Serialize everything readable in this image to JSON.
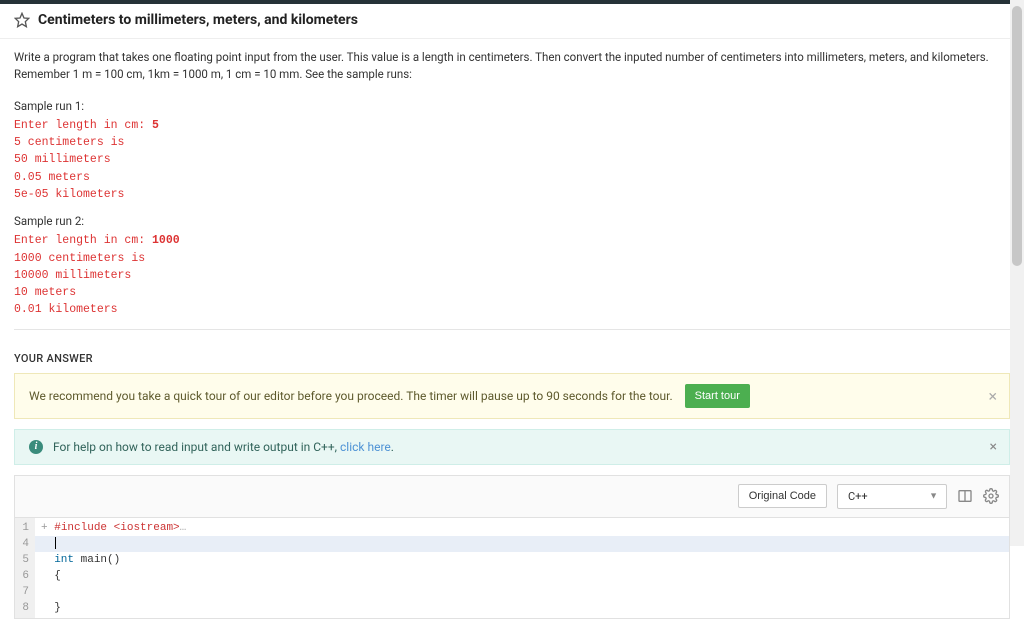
{
  "header": {
    "title": "Centimeters to millimeters, meters, and kilometers"
  },
  "description": "Write a program that takes one floating point input from the user.  This value is a length in centimeters.  Then convert the inputed number of centimeters into millimeters, meters, and kilometers.  Remember 1 m = 100 cm, 1km = 1000 m, 1 cm = 10 mm.  See the sample runs:",
  "samples": {
    "run1": {
      "label": "Sample run 1:",
      "lines": [
        {
          "text": "Enter length in cm: ",
          "bold": false,
          "suffix": "5",
          "suffix_bold": true
        },
        {
          "text": "5 centimeters is"
        },
        {
          "text": "50 millimeters"
        },
        {
          "text": "0.05 meters"
        },
        {
          "text": "5e-05 kilometers"
        }
      ]
    },
    "run2": {
      "label": "Sample run 2:",
      "lines": [
        {
          "text": "Enter length in cm: ",
          "bold": false,
          "suffix": "1000",
          "suffix_bold": true
        },
        {
          "text": "1000 centimeters is"
        },
        {
          "text": "10000 millimeters"
        },
        {
          "text": "10 meters"
        },
        {
          "text": "0.01 kilometers"
        }
      ]
    }
  },
  "your_answer_label": "YOUR ANSWER",
  "tour": {
    "text": "We recommend you take a quick tour of our editor before you proceed. The timer will pause up to 90 seconds for the tour.",
    "button": "Start tour"
  },
  "help": {
    "prefix": "For help on how to read input and write output in C++, ",
    "link": "click here",
    "suffix": "."
  },
  "toolbar": {
    "original_code": "Original Code",
    "language": "C++"
  },
  "code": {
    "gutter": [
      "1",
      "4",
      "5",
      "6",
      "7",
      "8"
    ],
    "lines": {
      "l1_fold": "+",
      "l1_pp": "#include",
      "l1_hdr": "<iostream>",
      "l1_dots": "…",
      "l2": "",
      "l3_kw": "int",
      "l3_rest": " main()",
      "l4": "{",
      "l5": "",
      "l6": "}"
    }
  }
}
